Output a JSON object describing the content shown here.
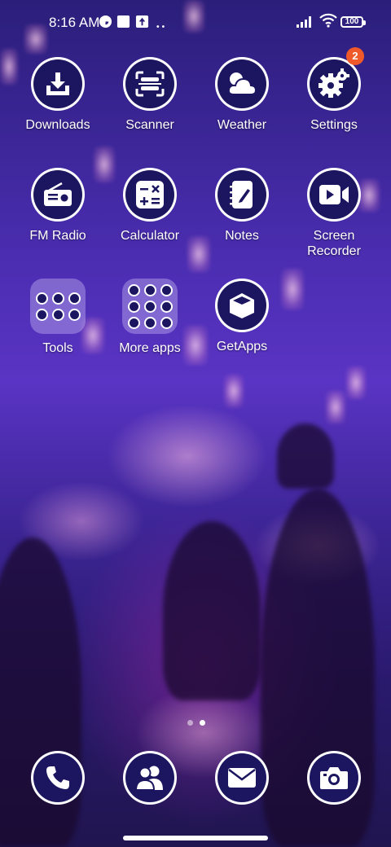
{
  "status_bar": {
    "time": "8:16 AM",
    "battery": "100",
    "icons": [
      "vpn-icon",
      "square-icon",
      "upload-icon",
      "more-dots-icon",
      "signal-icon",
      "wifi-icon",
      "battery-icon"
    ]
  },
  "apps_row1": [
    {
      "label": "Downloads",
      "icon": "download-icon"
    },
    {
      "label": "Scanner",
      "icon": "scanner-icon"
    },
    {
      "label": "Weather",
      "icon": "weather-icon"
    },
    {
      "label": "Settings",
      "icon": "gear-icon",
      "badge": "2"
    }
  ],
  "apps_row2": [
    {
      "label": "FM Radio",
      "icon": "radio-icon"
    },
    {
      "label": "Calculator",
      "icon": "calculator-icon"
    },
    {
      "label": "Notes",
      "icon": "notes-icon"
    },
    {
      "label": "Screen\nRecorder",
      "icon": "video-camera-icon"
    }
  ],
  "apps_row3": [
    {
      "label": "Tools",
      "icon": "folder-icon"
    },
    {
      "label": "More apps",
      "icon": "folder-icon"
    },
    {
      "label": "GetApps",
      "icon": "box-icon"
    }
  ],
  "dock": [
    {
      "icon": "phone-icon"
    },
    {
      "icon": "contacts-icon"
    },
    {
      "icon": "mail-icon"
    },
    {
      "icon": "camera-icon"
    }
  ],
  "colors": {
    "icon_bg": "#1c1660",
    "badge": "#f05a2a"
  },
  "page_indicator": {
    "pages": 2,
    "active": 2
  }
}
